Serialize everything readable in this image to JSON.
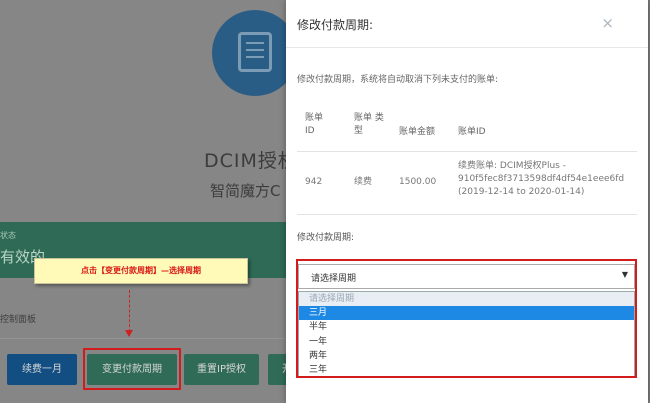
{
  "background": {
    "product_name": "DCIM授权",
    "company_name": "智简魔方C",
    "status_label": "状态",
    "status_value": "有效的",
    "panel_label": "控制面板",
    "buttons": {
      "renew": "续费一月",
      "change_cycle": "变更付款周期",
      "reset_ip": "重置IP授权",
      "more": "开"
    }
  },
  "annotation": {
    "callout_text": "点击【变更付款周期】—选择周期"
  },
  "modal": {
    "title": "修改付款周期:",
    "close_glyph": "×",
    "description": "修改付款周期，系统将自动取消下列未支付的账单:",
    "table": {
      "headers": {
        "id": "账单 ID",
        "type": "账单 类型",
        "amount": "账单金额",
        "bill_id": "账单ID"
      },
      "rows": [
        {
          "id": "942",
          "type": "续费",
          "amount": "1500.00",
          "bill_id": "续费账单: DCIM授权Plus - 910f5fec8f3713598df4df54e1eee6fd (2019-12-14 to 2020-01-14)"
        }
      ]
    },
    "cycle_label": "修改付款周期:",
    "select": {
      "value": "请选择周期",
      "caret": "▼",
      "options": [
        "请选择周期",
        "三月",
        "半年",
        "一年",
        "两年",
        "三年"
      ],
      "selected_index": 1
    }
  },
  "colors": {
    "accent_blue": "#1e88e5",
    "highlight_red": "#d21b1b",
    "callout_bg": "#fffab8"
  }
}
